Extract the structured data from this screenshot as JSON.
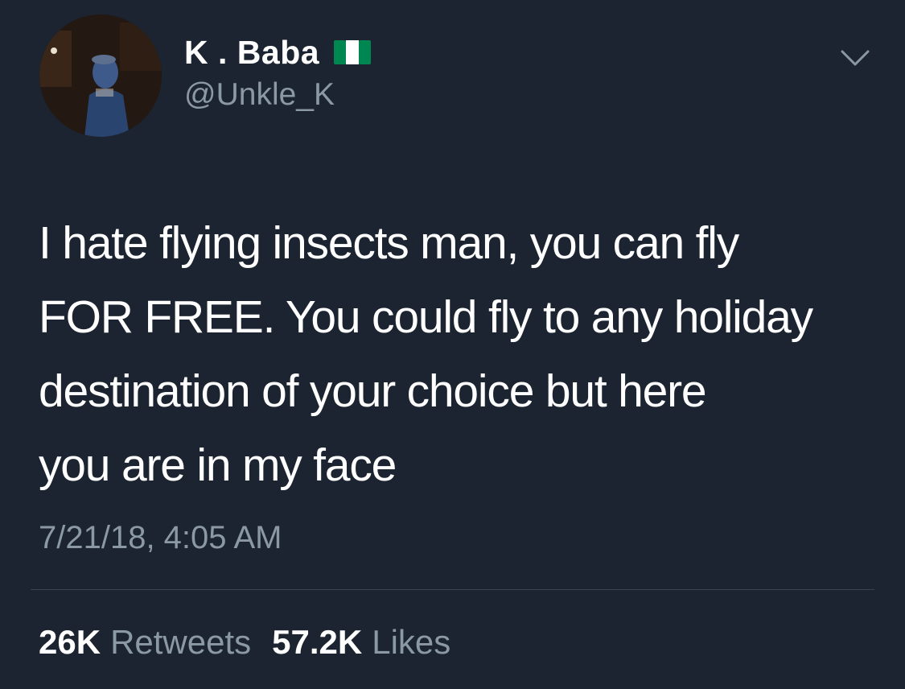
{
  "author": {
    "display_name": "K . Baba",
    "handle": "@Unkle_K",
    "flag_icon": "nigeria-flag-icon"
  },
  "tweet": {
    "lines": [
      "I hate flying insects man, you can fly",
      "FOR FREE. You could fly to any holiday",
      "destination of your choice but here",
      "you are in my face"
    ],
    "timestamp": "7/21/18, 4:05 AM"
  },
  "stats": {
    "retweets_count": "26K",
    "retweets_label": "Retweets",
    "likes_count": "57.2K",
    "likes_label": "Likes"
  },
  "colors": {
    "background": "#1b2430",
    "primary_text": "#ffffff",
    "secondary_text": "#8b98a5",
    "divider": "#38444d",
    "flag_green": "#008751",
    "flag_white": "#ffffff"
  },
  "icons": {
    "menu": "chevron-down-icon"
  }
}
